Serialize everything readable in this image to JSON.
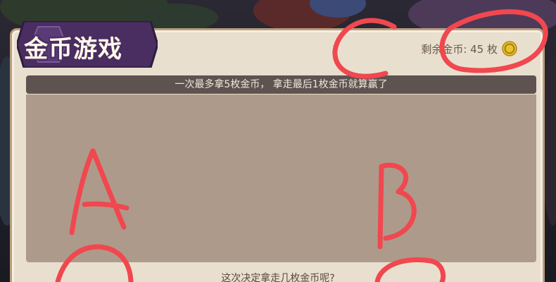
{
  "dialog": {
    "title": "金币游戏",
    "coins_remaining_label": "剩余金币: 45 枚",
    "instruction": "一次最多拿5枚金币， 拿走最后1枚金币就算赢了",
    "question": "这次决定拿走几枚金币呢?"
  },
  "annotations": {
    "marks": [
      "A",
      "B",
      "C"
    ],
    "ink_color": "#f1474f"
  },
  "colors": {
    "panel": "#e9dfcf",
    "instruction_bar": "#5e5351",
    "content_area": "#ae9a8b",
    "title_plate": "#4a2e62",
    "coin": "#e8c22f"
  },
  "icons": {
    "coin": "coin-icon"
  }
}
